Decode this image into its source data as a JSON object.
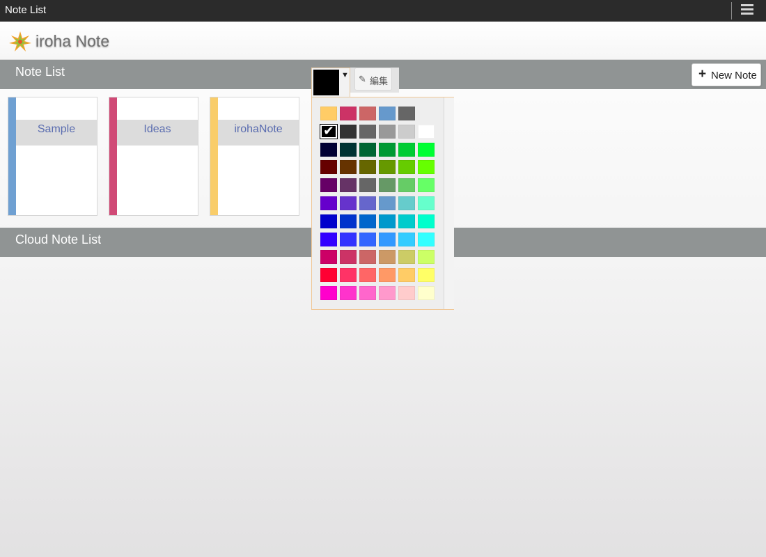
{
  "app": {
    "title": "Note List",
    "brand": "iroha Note"
  },
  "sections": {
    "notes_title": "Note List",
    "cloud_title": "Cloud Note List"
  },
  "toolbar": {
    "new_note_label": "New Note",
    "edit_label": "編集"
  },
  "icons": {
    "menu": "hamburger-menu-icon",
    "plus": "plus-icon",
    "edit": "pencil-square-icon",
    "dropdown": "triangle-down-icon",
    "check": "checkmark-icon",
    "logo": "maple-leaf-icon"
  },
  "notes": [
    {
      "title": "Sample",
      "color": "#6fa0d2"
    },
    {
      "title": "Ideas",
      "color": "#d04a76"
    },
    {
      "title": "irohaNote",
      "color": "#f9cd6a"
    }
  ],
  "color_picker": {
    "current_color": "#000000",
    "selected_color": "#000000",
    "rows": [
      [
        "#ffcc66",
        "#cc3366",
        "#cc6666",
        "#6699cc",
        "#666666"
      ],
      [
        "#000000",
        "#333333",
        "#666666",
        "#999999",
        "#cccccc",
        "#ffffff"
      ],
      [
        "#000033",
        "#003333",
        "#006633",
        "#009933",
        "#00cc33",
        "#00ff33"
      ],
      [
        "#660000",
        "#663300",
        "#666600",
        "#669900",
        "#66cc00",
        "#66ff00"
      ],
      [
        "#660066",
        "#663366",
        "#666666",
        "#669966",
        "#66cc66",
        "#66ff66"
      ],
      [
        "#6600cc",
        "#6633cc",
        "#6666cc",
        "#6699cc",
        "#66cccc",
        "#66ffcc"
      ],
      [
        "#0000cc",
        "#0033cc",
        "#0066cc",
        "#0099cc",
        "#00cccc",
        "#00ffcc"
      ],
      [
        "#3300ff",
        "#3333ff",
        "#3366ff",
        "#3399ff",
        "#33ccff",
        "#33ffff"
      ],
      [
        "#cc0066",
        "#cc3366",
        "#cc6666",
        "#cc9966",
        "#cccc66",
        "#ccff66"
      ],
      [
        "#ff0033",
        "#ff3366",
        "#ff6666",
        "#ff9966",
        "#ffcc66",
        "#ffff66"
      ],
      [
        "#ff00cc",
        "#ff33cc",
        "#ff66cc",
        "#ff99cc",
        "#ffcccc",
        "#ffffcc"
      ]
    ]
  }
}
